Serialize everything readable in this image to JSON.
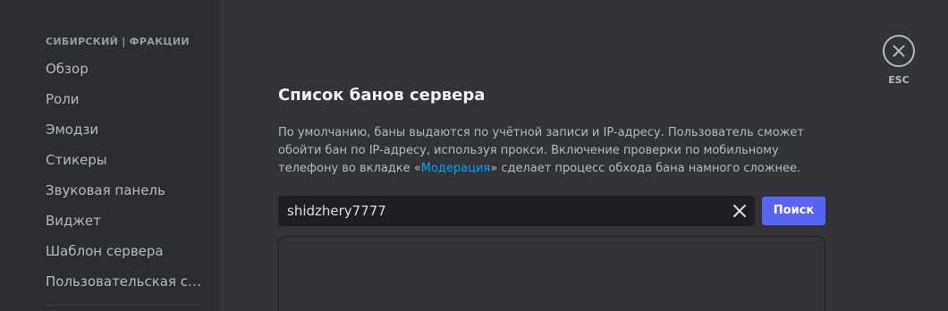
{
  "sidebar": {
    "server_name": "СИБИРСКИЙ | ФРАКЦИИ",
    "items": [
      {
        "label": "Обзор"
      },
      {
        "label": "Роли"
      },
      {
        "label": "Эмодзи"
      },
      {
        "label": "Стикеры"
      },
      {
        "label": "Звуковая панель"
      },
      {
        "label": "Виджет"
      },
      {
        "label": "Шаблон сервера"
      },
      {
        "label": "Пользовательская сс..."
      }
    ]
  },
  "main": {
    "title": "Список банов сервера",
    "description_part1": "По умолчанию, баны выдаются по учётной записи и IP-адресу. Пользователь сможет обойти бан по IP-адресу, используя прокси. Включение проверки по мобильному телефону во вкладке «",
    "description_link": "Модерация",
    "description_part2": "» сделает процесс обхода бана намного сложнее.",
    "search": {
      "value": "shidzhery7777",
      "button_label": "Поиск"
    }
  },
  "close": {
    "esc_label": "ESC"
  },
  "colors": {
    "accent": "#5865f2",
    "link": "#00a8fc",
    "background": "#313338",
    "sidebar": "#2b2d31"
  },
  "icons": {
    "clear": "close-icon",
    "close": "close-icon"
  }
}
